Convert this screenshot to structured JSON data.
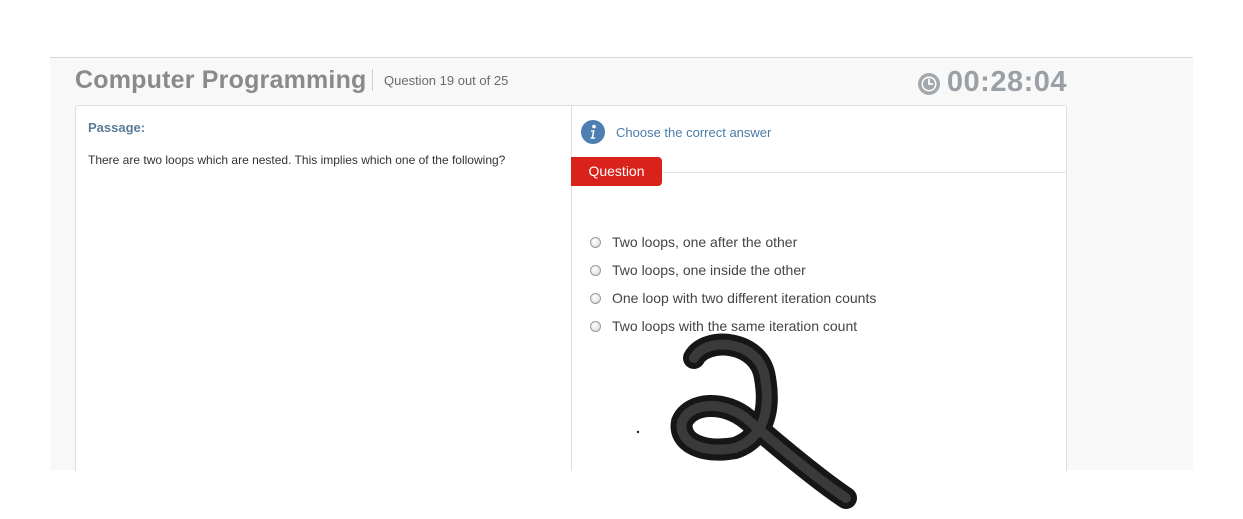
{
  "header": {
    "title": "Computer Programming",
    "question_counter": "Question 19 out of 25",
    "timer": "00:28:04"
  },
  "passage": {
    "label": "Passage:",
    "text": "There are two loops which are nested. This implies which one of the following?"
  },
  "question": {
    "instruction": "Choose the correct answer",
    "tab_label": "Question",
    "options": [
      {
        "label": "Two loops, one after the other",
        "selected": false
      },
      {
        "label": "Two loops, one inside the other",
        "selected": false
      },
      {
        "label": "One loop with two different iteration counts",
        "selected": false
      },
      {
        "label": "Two loops with the same iteration count",
        "selected": false
      }
    ]
  },
  "colors": {
    "accent_red": "#d9221b",
    "link_blue": "#4a7aa6",
    "title_gray": "#8a8a8a",
    "timer_gray": "#9aa0a6"
  },
  "icons": {
    "timer": "clock-icon",
    "instruction": "info-icon"
  }
}
